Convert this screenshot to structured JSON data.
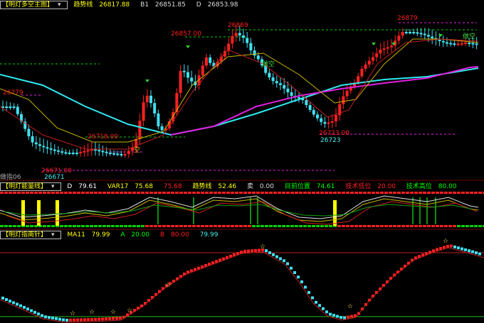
{
  "main": {
    "title": "【明灯多空主图】",
    "caret": "▾",
    "trend_label": "趋势线",
    "trend_value": "26817.88",
    "b1_label": "B1",
    "b1_value": "26851.85",
    "d_label": "D",
    "d_value": "26853.98",
    "price_labels": [
      "26857.00",
      "26869",
      "26879",
      "26779",
      "26718.00",
      "26671",
      "26671.00",
      "26723.00",
      "26723",
      "做空",
      "做空",
      "空"
    ],
    "left_marker": "做指06"
  },
  "mid": {
    "title": "【明灯能量线】",
    "caret": "▾",
    "d_label": "D",
    "d_value": "79.61",
    "var17_label": "VAR17",
    "var17_value": "75.68",
    "extra_value": "75.68",
    "trend_label": "趋势线",
    "trend_value": "52.46",
    "buy_label": "卖",
    "buy_value": "0.00",
    "pos_label": "目前位置",
    "pos_value": "74.61",
    "low_label": "技术低位",
    "low_value": "20.00",
    "high_label": "技术高位",
    "high_value": "80.00"
  },
  "bottom": {
    "title": "【明灯指南针】",
    "caret": "▾",
    "ma_label": "MA11",
    "ma_value": "79.99",
    "a_label": "A",
    "a_value": "20.00",
    "b_label": "B",
    "b_value": "80.00",
    "extra_value": "79.99"
  },
  "colors": {
    "up": "#ff2020",
    "down": "#40e0f0",
    "magenta": "#e020e0",
    "yellow": "#ffff00",
    "green": "#00d000",
    "white": "#ffffff"
  }
}
